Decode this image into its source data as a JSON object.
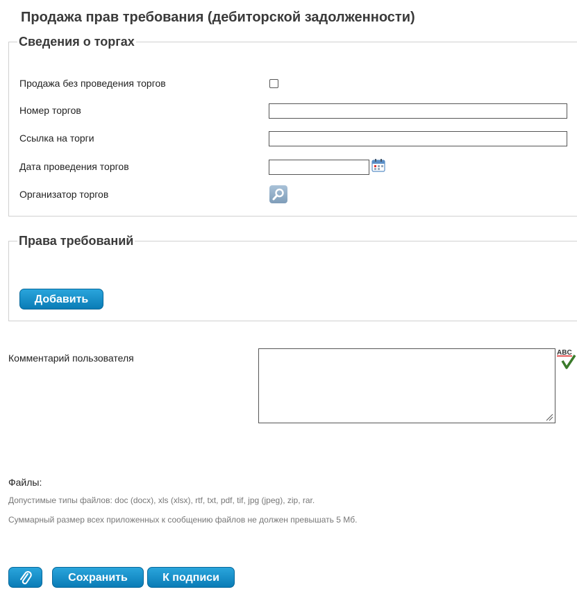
{
  "page": {
    "title": "Продажа прав требования (дебиторской задолженности)"
  },
  "auction": {
    "legend": "Сведения о торгах",
    "no_auction_label": "Продажа без проведения торгов",
    "no_auction_checked": false,
    "number_label": "Номер торгов",
    "number_value": "",
    "link_label": "Ссылка на торги",
    "link_value": "",
    "date_label": "Дата проведения торгов",
    "date_value": "",
    "organizer_label": "Организатор торгов"
  },
  "rights": {
    "legend": "Права требований",
    "add_button": "Добавить"
  },
  "comment": {
    "label": "Комментарий пользователя",
    "value": ""
  },
  "files": {
    "label": "Файлы:",
    "types_hint": "Допустимые типы файлов: doc (docx), xls (xlsx), rtf, txt, pdf, tif, jpg (jpeg), zip, rar.",
    "size_hint": "Суммарный размер всех приложенных к сообщению файлов не должен превышать 5 Мб."
  },
  "actions": {
    "save": "Сохранить",
    "to_sign": "К подписи"
  },
  "icons": {
    "calendar": "calendar-icon",
    "lookup": "search-icon",
    "spellcheck": "spellcheck-icon",
    "attach": "paperclip-icon",
    "resize": "resize-grip-icon"
  },
  "colors": {
    "button": "#0f8ac4",
    "legend_text": "#3a3a3a",
    "hint_text": "#777777"
  }
}
